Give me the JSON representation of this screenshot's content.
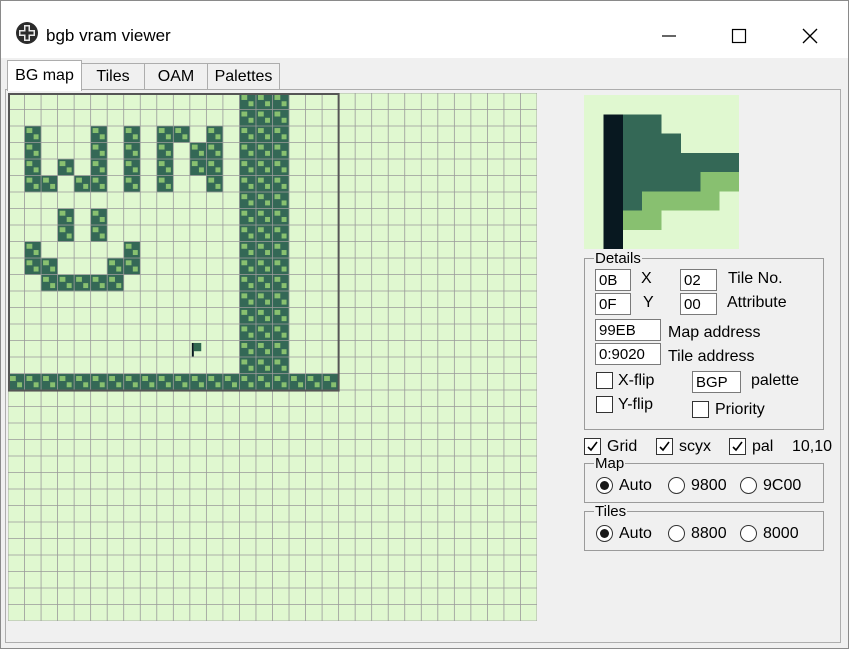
{
  "window": {
    "title": "bgb vram viewer",
    "controls": {
      "minimize": "minimize-icon",
      "maximize": "maximize-icon",
      "close": "close-icon"
    }
  },
  "tabs": [
    {
      "label": "BG map",
      "active": true
    },
    {
      "label": "Tiles",
      "active": false
    },
    {
      "label": "OAM",
      "active": false
    },
    {
      "label": "Palettes",
      "active": false
    }
  ],
  "map_palette": {
    "light": "#e0f8d0",
    "grid": "#9a9a9a",
    "wall_dark": "#346856",
    "wall_mid": "#88c070",
    "accent": "#306850"
  },
  "details": {
    "title": "Details",
    "x_value": "0B",
    "x_label": "X",
    "y_value": "0F",
    "y_label": "Y",
    "tile_no_value": "02",
    "tile_no_label": "Tile No.",
    "attribute_value": "00",
    "attribute_label": "Attribute",
    "map_address_value": "99EB",
    "map_address_label": "Map address",
    "tile_address_value": "0:9020",
    "tile_address_label": "Tile address",
    "xflip_label": "X-flip",
    "xflip_checked": false,
    "yflip_label": "Y-flip",
    "yflip_checked": false,
    "palette_value": "BGP",
    "palette_label": "palette",
    "priority_label": "Priority",
    "priority_checked": false
  },
  "options": {
    "grid_label": "Grid",
    "grid_checked": true,
    "scyx_label": "scyx",
    "scyx_checked": true,
    "pal_label": "pal",
    "pal_checked": true,
    "coords": "10,10"
  },
  "map_group": {
    "title": "Map",
    "options": [
      "Auto",
      "9800",
      "9C00"
    ],
    "selected": "Auto"
  },
  "tiles_group": {
    "title": "Tiles",
    "options": [
      "Auto",
      "8800",
      "8000"
    ],
    "selected": "Auto"
  }
}
